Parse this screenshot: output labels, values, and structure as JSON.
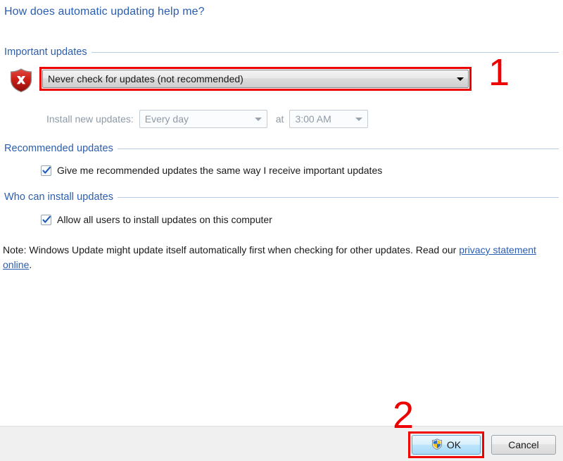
{
  "dialog": {
    "help_link": "How does automatic updating help me?",
    "note_text_before": "Note: Windows Update might update itself automatically first when checking for other updates.  Read our ",
    "note_link": "privacy statement online",
    "note_text_after": "."
  },
  "groups": {
    "important": {
      "title": "Important updates",
      "icon": "shield-error-icon",
      "combobox": {
        "value": "Never check for updates (not recommended)",
        "arrow_icon": "chevron-down-icon",
        "highlighted": true
      },
      "schedule": {
        "label": "Install new updates:",
        "frequency_value": "Every day",
        "at_label": "at",
        "time_value": "3:00 AM",
        "enabled": false
      }
    },
    "recommended": {
      "title": "Recommended updates",
      "checkbox_label": "Give me recommended updates the same way I receive important updates",
      "checked": true
    },
    "who_can_install": {
      "title": "Who can install updates",
      "checkbox_label": "Allow all users to install updates on this computer",
      "checked": true
    }
  },
  "buttons": {
    "ok_label": "OK",
    "ok_icon": "uac-shield-icon",
    "cancel_label": "Cancel"
  },
  "annotations": {
    "step_one": "1",
    "step_two": "2"
  },
  "colors": {
    "annotation_red": "#ee0000",
    "link_blue": "#2a5db0",
    "group_rule": "#b8cce4",
    "disabled_text": "#8e9aa6",
    "ok_button_blue": "#bee6fd"
  }
}
